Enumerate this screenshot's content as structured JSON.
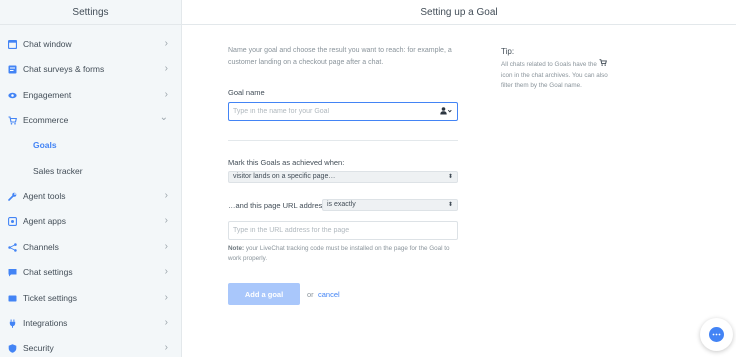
{
  "sidebar": {
    "title": "Settings",
    "items": [
      {
        "label": "Chat window",
        "icon": "window-icon",
        "chevron": "›"
      },
      {
        "label": "Chat surveys & forms",
        "icon": "form-icon",
        "chevron": "›"
      },
      {
        "label": "Engagement",
        "icon": "eye-icon",
        "chevron": "›"
      },
      {
        "label": "Ecommerce",
        "icon": "cart-icon",
        "chevron": "⌄",
        "expanded": true
      },
      {
        "label": "Agent tools",
        "icon": "wrench-icon",
        "chevron": "›"
      },
      {
        "label": "Agent apps",
        "icon": "apps-icon",
        "chevron": "›"
      },
      {
        "label": "Channels",
        "icon": "share-icon",
        "chevron": "›"
      },
      {
        "label": "Chat settings",
        "icon": "chat-icon",
        "chevron": "›"
      },
      {
        "label": "Ticket settings",
        "icon": "ticket-icon",
        "chevron": "›"
      },
      {
        "label": "Integrations",
        "icon": "plug-icon",
        "chevron": "›"
      },
      {
        "label": "Security",
        "icon": "shield-icon",
        "chevron": "›"
      }
    ],
    "subitems": [
      {
        "label": "Goals",
        "active": true
      },
      {
        "label": "Sales tracker",
        "active": false
      }
    ]
  },
  "main": {
    "title": "Setting up a Goal",
    "intro": "Name your goal and choose the result you want to reach: for example, a customer landing on a checkout page after a chat.",
    "goal_name_label": "Goal name",
    "goal_name_placeholder": "Type in the name for your Goal",
    "achieved_label": "Mark this Goals as achieved when:",
    "achieved_select": "visitor lands on a specific page…",
    "url_label": "…and this page URL address",
    "url_match_select": "is exactly",
    "url_placeholder": "Type in the URL address for the page",
    "note_bold": "Note:",
    "note_text": " your LiveChat tracking code must be installed on the page for the Goal to work properly.",
    "add_button": "Add a goal",
    "or_text": "or",
    "cancel_link": "cancel"
  },
  "tip": {
    "title": "Tip:",
    "text_before": "All chats related to Goals have the",
    "text_after": "icon in the chat archives. You can also filter them by the Goal name."
  },
  "colors": {
    "accent": "#4384f5",
    "sidebar_bg": "#f3f7f9",
    "button_disabled": "#a9c7fb"
  }
}
